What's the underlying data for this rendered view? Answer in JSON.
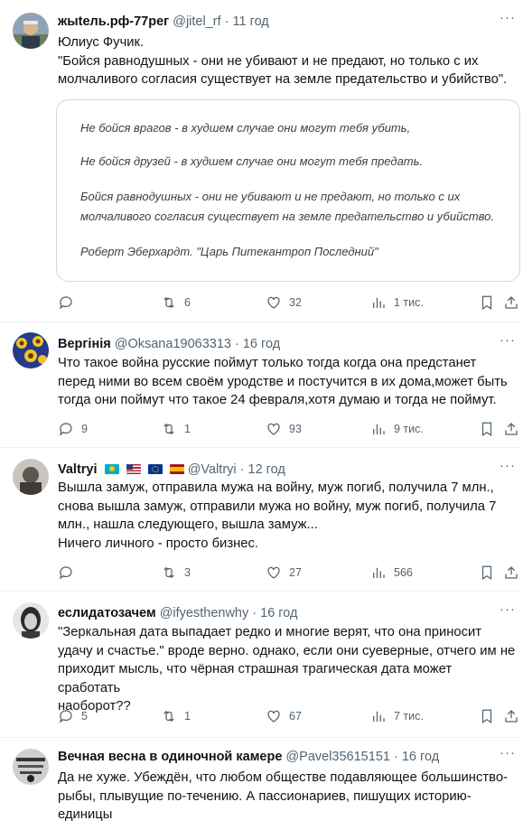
{
  "tweets": [
    {
      "name": "жыtель.рф-77рег",
      "handle": "@jitel_rf",
      "sep": " · ",
      "time": "11 год",
      "lines": [
        "Юлиус Фучик.",
        "\"Бойся равнодушных - они не убивают и не предают, но только с их",
        "молчаливого согласия существует на земле предательство и убийство\"."
      ],
      "quote_lines": [
        "Не бойся врагов - в худшем случае они могут тебя убить,",
        "Не бойся друзей - в худшем случае они могут тебя предать.",
        "Бойся равнодушных - они не убивают и не предают, но только с их",
        "молчаливого согласия существует на земле предательство и убийство.",
        "Роберт Эберхардт. \"Царь Питекантроп Последний\""
      ],
      "actions": {
        "replies": "",
        "retweets": "6",
        "likes": "32",
        "views": "1 тис."
      }
    },
    {
      "name": "Вергінія",
      "handle": "@Oksana19063313",
      "sep": " · ",
      "time": "16 год",
      "lines": [
        "Что такое война русские поймут только тогда когда она предстанет",
        "перед ними во всем своём уродстве и постучится в их дома,может быть",
        "тогда они поймут что такое 24 февраля,хотя думаю и тогда не поймут."
      ],
      "actions": {
        "replies": "9",
        "retweets": "1",
        "likes": "93",
        "views": "9 тис."
      }
    },
    {
      "name": "Valtryi",
      "handle": "@Valtryi",
      "sep": " · ",
      "time": "12 год",
      "lines": [
        "Вышла замуж, отправила мужа на войну, муж погиб, получила 7 млн.,",
        "снова вышла замуж, отправили мужа но войну, муж погиб, получила 7",
        "млн., нашла следующего, вышла замуж...",
        "Ничего личного - просто бизнес."
      ],
      "actions": {
        "replies": "",
        "retweets": "3",
        "likes": "27",
        "views": "566"
      }
    },
    {
      "name": "еслидатозачем",
      "handle": "@ifyesthenwhy",
      "sep": " · ",
      "time": "16 год",
      "lines": [
        "\"Зеркальная дата выпадает редко и многие верят, что она приносит",
        "удачу и счастье.\" вроде верно. однако, если они суеверные, отчего им не",
        "приходит мысль, что чёрная страшная трагическая дата может сработать",
        "наоборот??"
      ],
      "actions": {
        "replies": "5",
        "retweets": "1",
        "likes": "67",
        "views": "7 тис."
      }
    },
    {
      "name": "Вечная весна в одиночной камере",
      "handle": "@Pavel35615151",
      "sep": " · ",
      "time": "16 год",
      "lines": [
        "Да не хуже. Убеждён, что любом обществе подавляющее большинство-",
        "рыбы, плывущие по-течению. А пассионариев, пишущих историю-",
        "единицы"
      ]
    }
  ],
  "more_label": "···"
}
